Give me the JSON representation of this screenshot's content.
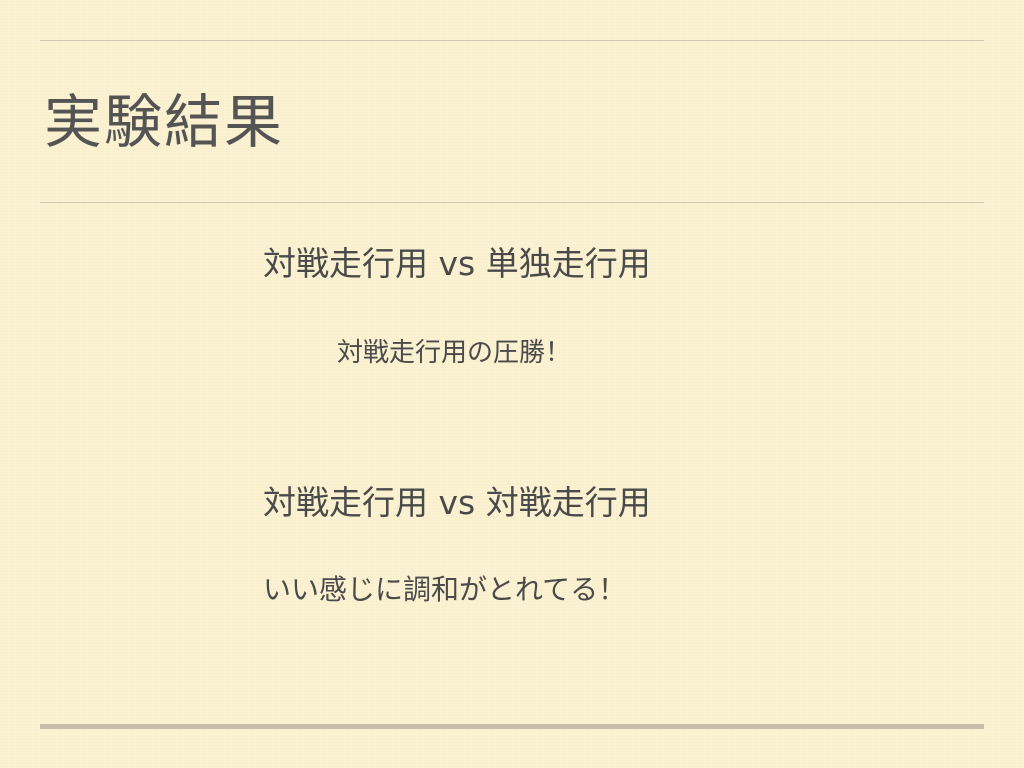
{
  "slide": {
    "title": "実験結果",
    "blocks": [
      {
        "heading": "対戦走行用 vs 単独走行用",
        "note": "対戦走行用の圧勝！"
      },
      {
        "heading": "対戦走行用 vs 対戦走行用",
        "note": "いい感じに調和がとれてる！"
      }
    ]
  }
}
